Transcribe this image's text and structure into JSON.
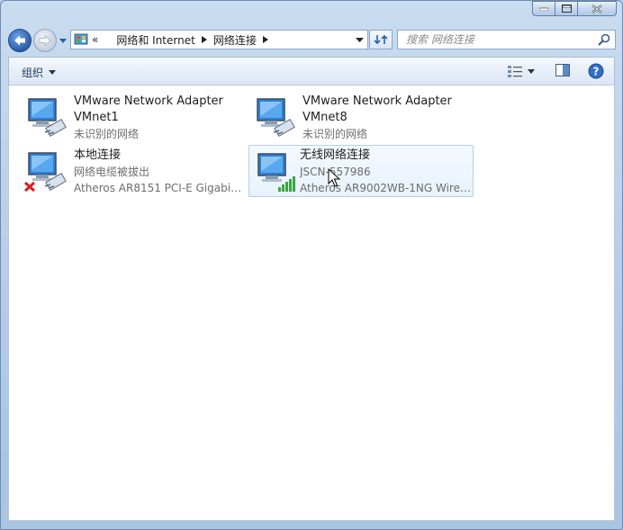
{
  "nav": {
    "breadcrumb": [
      "网络和 Internet",
      "网络连接"
    ],
    "overflow_glyph": "«"
  },
  "search": {
    "placeholder": "搜索 网络连接"
  },
  "toolbar": {
    "organize_label": "组织"
  },
  "connections": [
    {
      "name": "VMware Network Adapter",
      "line2": "VMnet1",
      "status": "未识别的网络",
      "device": ""
    },
    {
      "name": "VMware Network Adapter",
      "line2": "VMnet8",
      "status": "未识别的网络",
      "device": ""
    },
    {
      "name": "本地连接",
      "line2": "",
      "status": "网络电缆被拔出",
      "device": "Atheros AR8151 PCI-E Gigabit ..."
    },
    {
      "name": "无线网络连接",
      "line2": "",
      "status": "JSCN-557986",
      "device": "Atheros AR9002WB-1NG Wirel..."
    }
  ],
  "colors": {
    "accent": "#2a5ea8",
    "signal": "#3aa640",
    "error": "#d3201c"
  },
  "icons": {
    "network": "network-adapter-icon",
    "disconnected": "red-x-icon",
    "wireless": "signal-bars-icon"
  }
}
